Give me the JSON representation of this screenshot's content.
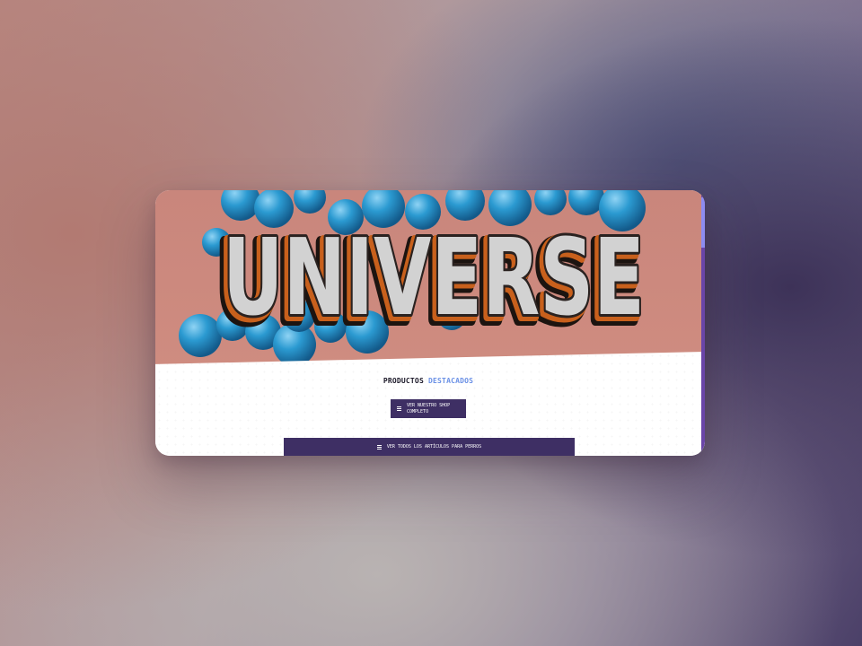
{
  "hero": {
    "logo_text": "UNIVERSE"
  },
  "featured": {
    "title_part1": "PRODUCTOS",
    "title_part2": "DESTACADOS"
  },
  "buttons": {
    "shop_label": "VER NUESTRO SHOP COMPLETO",
    "shop_icon": "menu-icon",
    "dogs_label": "VER TODOS LOS ARTÍCULOS PARA PERROS",
    "dogs_icon": "menu-icon"
  },
  "colors": {
    "accent": "#6b91e6",
    "button_bg": "#3e2f64",
    "scrollbar": "#6a45a8"
  }
}
